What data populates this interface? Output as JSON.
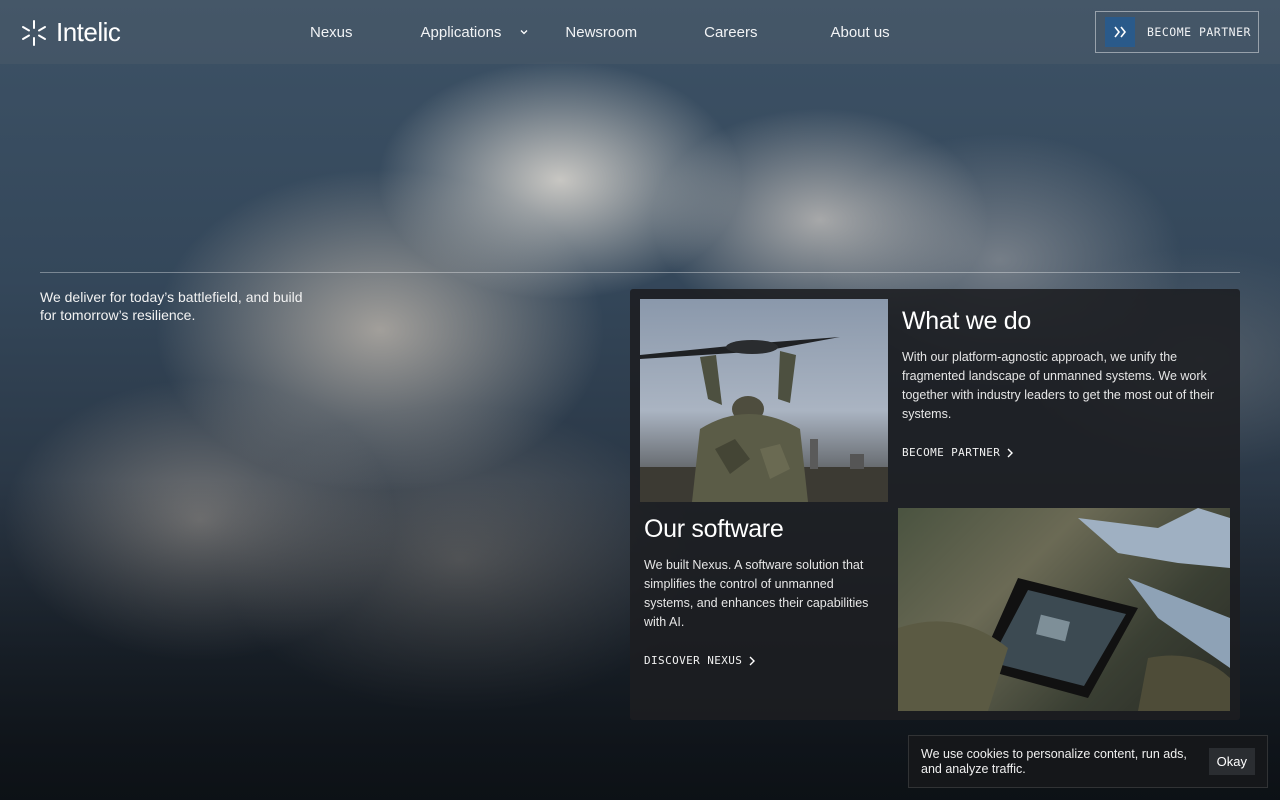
{
  "header": {
    "logo_text": "Intelic",
    "nav": [
      {
        "label": "Nexus"
      },
      {
        "label": "Applications"
      },
      {
        "label": "Newsroom"
      },
      {
        "label": "Careers"
      },
      {
        "label": "About us"
      }
    ],
    "partner_button_label": "BECOME PARTNER"
  },
  "hero": {
    "tagline": "We deliver for today’s battlefield, and build for tomorrow’s resilience."
  },
  "what_we_do": {
    "title": "What we do",
    "body": "With our platform-agnostic approach, we unify the fragmented landscape of unmanned systems. We work together with industry leaders to get the most out of their systems.",
    "link_label": "BECOME PARTNER"
  },
  "our_software": {
    "title": "Our software",
    "body": "We built Nexus. A software solution that simplifies the control of unmanned systems, and enhances their capabilities with AI.",
    "link_label": "DISCOVER NEXUS"
  },
  "cookie": {
    "text": "We use cookies to personalize content, run ads, and analyze traffic.",
    "button_label": "Okay"
  },
  "colors": {
    "accent": "#2a5a8a",
    "panel": "#1c1e21"
  },
  "icons": {
    "logo": "star-burst-icon",
    "nav_dropdown": "chevron-down-icon",
    "partner_arrows": "double-chevron-right-icon",
    "link_arrow": "chevron-right-icon"
  }
}
